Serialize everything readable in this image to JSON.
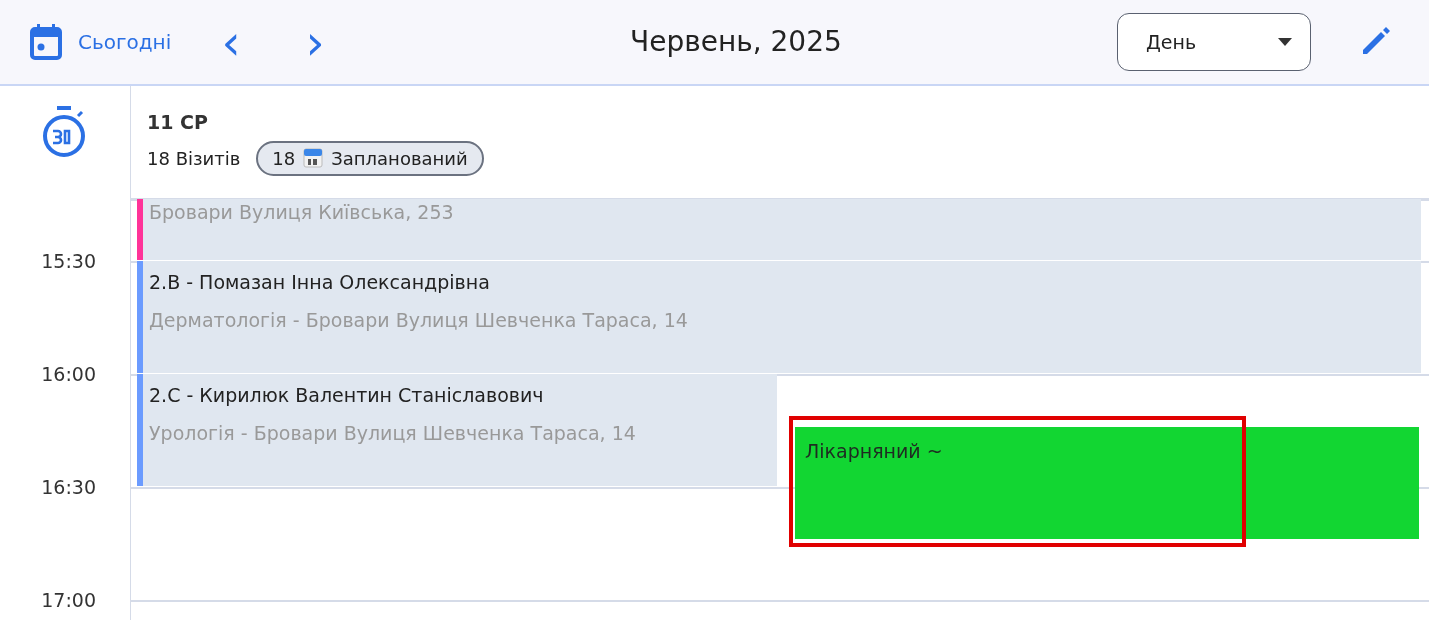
{
  "toolbar": {
    "today": "Сьогодні",
    "prev": "‹",
    "next": "›",
    "title": "Червень, 2025",
    "view": "День"
  },
  "day": {
    "label": "11 СР",
    "visits": "18 Візитів",
    "chip": {
      "count": "18",
      "label": "Запланований"
    }
  },
  "times": [
    "15:30",
    "16:00",
    "16:30",
    "17:00"
  ],
  "events": [
    {
      "kind": "appointment",
      "subtitle": "Бровари Вулиця Київська, 253",
      "color": "#ff3399"
    },
    {
      "kind": "appointment",
      "title": "2.В - Помазан Інна Олександрівна",
      "subtitle": "Дерматологія - Бровари Вулиця Шевченка Тараса, 14",
      "color": "#6b9bff"
    },
    {
      "kind": "appointment",
      "title": "2.С - Кирилюк Валентин Станіславович",
      "subtitle": "Урологія - Бровари Вулиця Шевченка Тараса, 14",
      "color": "#6b9bff"
    },
    {
      "kind": "absence",
      "title": "Лікарняний ~",
      "color": "#12d632"
    }
  ]
}
